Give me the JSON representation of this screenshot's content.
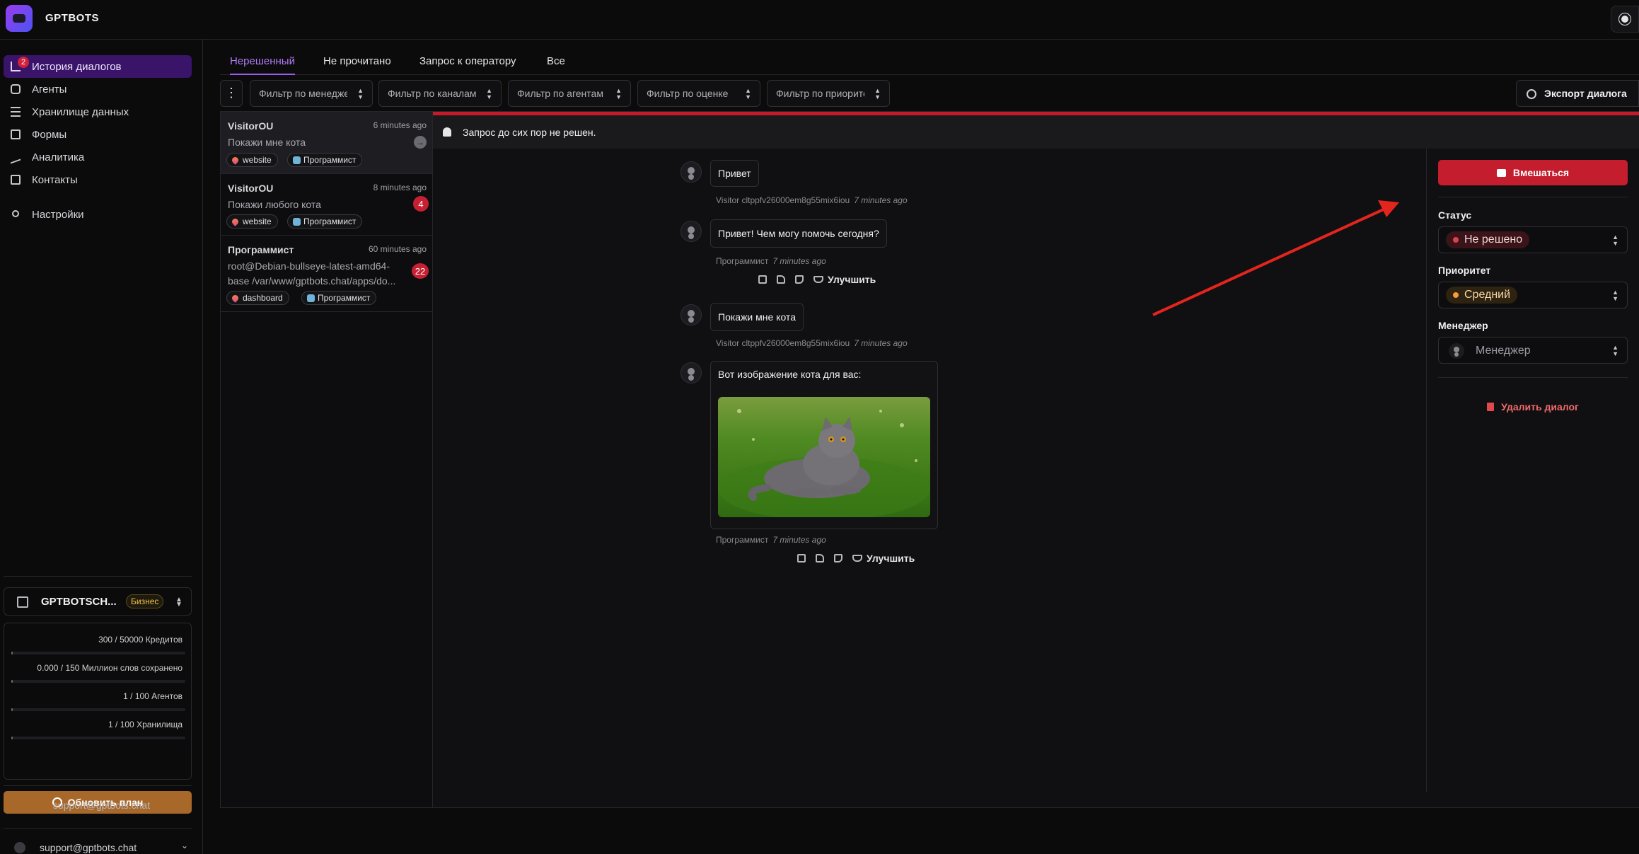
{
  "app": {
    "brand": "GPTBOTS"
  },
  "sidebar": {
    "items": [
      {
        "label": "История диалогов",
        "badge": "2",
        "active": true
      },
      {
        "label": "Агенты"
      },
      {
        "label": "Хранилище данных"
      },
      {
        "label": "Формы"
      },
      {
        "label": "Аналитика"
      },
      {
        "label": "Контакты"
      },
      {
        "label": "Настройки"
      }
    ],
    "org": {
      "name": "GPTBOTSCH...",
      "plan": "Бизнес"
    },
    "usage": [
      {
        "text": "300 / 50000 Кредитов",
        "fraction": 0.006
      },
      {
        "text": "0.000 / 150 Миллион слов сохранено",
        "fraction": 0.0
      },
      {
        "text": "1 / 100 Агентов",
        "fraction": 0.01
      },
      {
        "text": "1 / 100 Хранилища",
        "fraction": 0.01
      }
    ],
    "upgrade_label": "Обновить план",
    "support_email": "support@gptbots.chat",
    "user_email": "support@gptbots.chat"
  },
  "tabs": [
    "Нерешенный",
    "Не прочитано",
    "Запрос к оператору",
    "Все"
  ],
  "filters": {
    "manager": "Фильтр по менеджеру",
    "channel": "Фильтр по каналам",
    "agent": "Фильтр по агентам",
    "rating": "Фильтр по оценке",
    "priority": "Фильтр по приоритету",
    "export_label": "Экспорт диалога"
  },
  "conversations": [
    {
      "name": "VisitorOU",
      "time": "6 minutes ago",
      "preview": "Покажи мне кота",
      "tags": [
        "website",
        "Программист"
      ]
    },
    {
      "name": "VisitorOU",
      "time": "8 minutes ago",
      "preview": "Покажи любого кота",
      "count": "4",
      "tags": [
        "website",
        "Программист"
      ]
    },
    {
      "name": "Программист",
      "time": "60 minutes ago",
      "preview_line1": "root@Debian-bullseye-latest-amd64-",
      "preview_line2": "base /var/www/gptbots.chat/apps/do...",
      "count": "22",
      "tags": [
        "dashboard",
        "Программист"
      ]
    }
  ],
  "alert": "Запрос до сих пор не решен.",
  "messages": [
    {
      "text": "Привет",
      "sender": "Visitor cltppfv26000em8g55mix6iou",
      "time": "7 minutes ago"
    },
    {
      "text": "Привет! Чем могу помочь сегодня?",
      "sender": "Программист",
      "time": "7 minutes ago",
      "improve": "Улучшить"
    },
    {
      "text": "Покажи мне кота",
      "sender": "Visitor cltppfv26000em8g55mix6iou",
      "time": "7 minutes ago"
    },
    {
      "text": "Вот изображение кота для вас:",
      "sender": "Программист",
      "time": "7 minutes ago",
      "improve": "Улучшить"
    }
  ],
  "panel": {
    "intervene_label": "Вмешаться",
    "status_label": "Статус",
    "status_value": "Не решено",
    "priority_label": "Приоритет",
    "priority_value": "Средний",
    "manager_label": "Менеджер",
    "manager_placeholder": "Менеджер",
    "delete_label": "Удалить диалог"
  },
  "colors": {
    "accent": "#9b5cf0",
    "danger": "#c41e2e",
    "warning": "#f39c3b",
    "upgrade": "#a8682a"
  }
}
